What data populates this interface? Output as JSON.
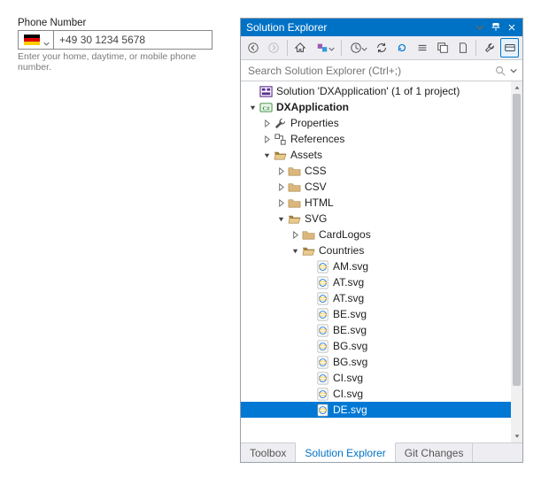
{
  "phone_form": {
    "label": "Phone Number",
    "value": "+49 30 1234 5678",
    "hint": "Enter your home, daytime, or mobile phone number.",
    "country_code": "DE"
  },
  "panel": {
    "title": "Solution Explorer",
    "search_placeholder": "Search Solution Explorer (Ctrl+;)",
    "tabs": [
      {
        "label": "Toolbox",
        "active": false
      },
      {
        "label": "Solution Explorer",
        "active": true
      },
      {
        "label": "Git Changes",
        "active": false
      }
    ]
  },
  "tree": [
    {
      "depth": 0,
      "label": "Solution 'DXApplication' (1 of 1 project)",
      "icon": "solution",
      "expander": "none"
    },
    {
      "depth": 0,
      "label": "DXApplication",
      "icon": "csproj",
      "expander": "open",
      "bold": true
    },
    {
      "depth": 1,
      "label": "Properties",
      "icon": "wrench",
      "expander": "closed"
    },
    {
      "depth": 1,
      "label": "References",
      "icon": "refs",
      "expander": "closed"
    },
    {
      "depth": 1,
      "label": "Assets",
      "icon": "folder-open",
      "expander": "open"
    },
    {
      "depth": 2,
      "label": "CSS",
      "icon": "folder",
      "expander": "closed"
    },
    {
      "depth": 2,
      "label": "CSV",
      "icon": "folder",
      "expander": "closed"
    },
    {
      "depth": 2,
      "label": "HTML",
      "icon": "folder",
      "expander": "closed"
    },
    {
      "depth": 2,
      "label": "SVG",
      "icon": "folder-open",
      "expander": "open"
    },
    {
      "depth": 3,
      "label": "CardLogos",
      "icon": "folder",
      "expander": "closed"
    },
    {
      "depth": 3,
      "label": "Countries",
      "icon": "folder-open",
      "expander": "open"
    },
    {
      "depth": 4,
      "label": "AM.svg",
      "icon": "svgfile",
      "expander": "none"
    },
    {
      "depth": 4,
      "label": "AT.svg",
      "icon": "svgfile",
      "expander": "none"
    },
    {
      "depth": 4,
      "label": "AT.svg",
      "icon": "svgfile",
      "expander": "none"
    },
    {
      "depth": 4,
      "label": "BE.svg",
      "icon": "svgfile",
      "expander": "none"
    },
    {
      "depth": 4,
      "label": "BE.svg",
      "icon": "svgfile",
      "expander": "none"
    },
    {
      "depth": 4,
      "label": "BG.svg",
      "icon": "svgfile",
      "expander": "none"
    },
    {
      "depth": 4,
      "label": "BG.svg",
      "icon": "svgfile",
      "expander": "none"
    },
    {
      "depth": 4,
      "label": "CI.svg",
      "icon": "svgfile",
      "expander": "none"
    },
    {
      "depth": 4,
      "label": "CI.svg",
      "icon": "svgfile",
      "expander": "none"
    },
    {
      "depth": 4,
      "label": "DE.svg",
      "icon": "svgfile",
      "expander": "none",
      "selected": true
    }
  ]
}
